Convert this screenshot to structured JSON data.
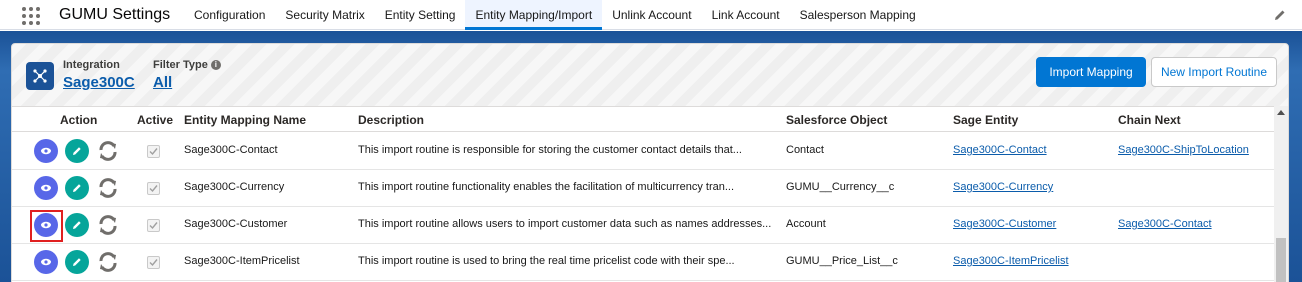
{
  "app": {
    "name": "GUMU Settings"
  },
  "nav": {
    "items": [
      {
        "label": "Configuration",
        "active": false
      },
      {
        "label": "Security Matrix",
        "active": false
      },
      {
        "label": "Entity Setting",
        "active": false
      },
      {
        "label": "Entity Mapping/Import",
        "active": true
      },
      {
        "label": "Unlink Account",
        "active": false
      },
      {
        "label": "Link Account",
        "active": false
      },
      {
        "label": "Salesperson Mapping",
        "active": false
      }
    ]
  },
  "header": {
    "integration_label": "Integration",
    "integration_value": "Sage300C",
    "filter_label": "Filter Type",
    "filter_value": "All",
    "import_mapping_label": "Import Mapping",
    "new_import_routine_label": "New Import Routine"
  },
  "table": {
    "columns": {
      "action": "Action",
      "active": "Active",
      "name": "Entity Mapping Name",
      "description": "Description",
      "sf_object": "Salesforce Object",
      "sage_entity": "Sage Entity",
      "chain_next": "Chain Next"
    },
    "rows": [
      {
        "name": "Sage300C-Contact",
        "description": "This import routine is responsible for storing the customer contact details that...",
        "sf_object": "Contact",
        "sage_entity": "Sage300C-Contact",
        "chain_next": "Sage300C-ShipToLocation",
        "active": true
      },
      {
        "name": "Sage300C-Currency",
        "description": "This import routine functionality enables the facilitation of multicurrency tran...",
        "sf_object": "GUMU__Currency__c",
        "sage_entity": "Sage300C-Currency",
        "chain_next": "",
        "active": true
      },
      {
        "name": "Sage300C-Customer",
        "description": "This import routine allows users to import customer data such as names addresses...",
        "sf_object": "Account",
        "sage_entity": "Sage300C-Customer",
        "chain_next": "Sage300C-Contact",
        "active": true,
        "highlighted": true
      },
      {
        "name": "Sage300C-ItemPricelist",
        "description": "This import routine is used to bring the real time pricelist code with their spe...",
        "sf_object": "GUMU__Price_List__c",
        "sage_entity": "Sage300C-ItemPricelist",
        "chain_next": "",
        "active": true
      }
    ]
  },
  "colors": {
    "brand_blue": "#0176d3",
    "band_blue": "#1b5297",
    "view_button": "#5867e8",
    "edit_button": "#06a59a",
    "highlight_border": "#e02020"
  }
}
